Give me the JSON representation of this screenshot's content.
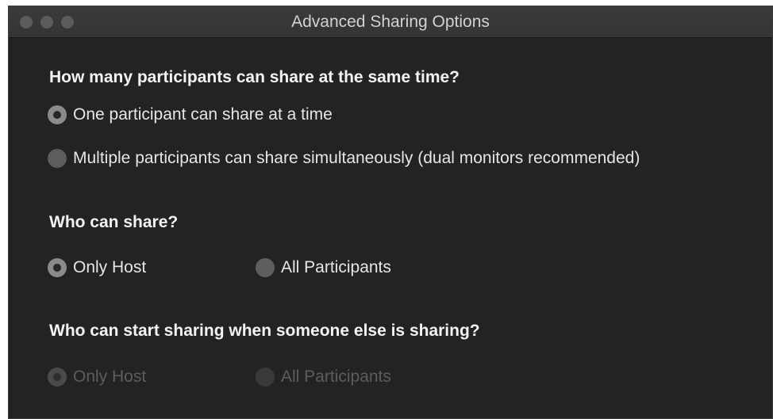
{
  "window": {
    "title": "Advanced Sharing Options"
  },
  "sections": [
    {
      "heading": "How many participants can share at the same time?",
      "options": [
        {
          "label": "One participant can share at a time",
          "selected": true
        },
        {
          "label": "Multiple participants can share simultaneously (dual monitors recommended)",
          "selected": false
        }
      ]
    },
    {
      "heading": "Who can share?",
      "options": [
        {
          "label": "Only Host",
          "selected": true
        },
        {
          "label": "All Participants",
          "selected": false
        }
      ]
    },
    {
      "heading": "Who can start sharing when someone else is sharing?",
      "disabled": true,
      "options": [
        {
          "label": "Only Host",
          "selected": true
        },
        {
          "label": "All Participants",
          "selected": false
        }
      ]
    }
  ]
}
